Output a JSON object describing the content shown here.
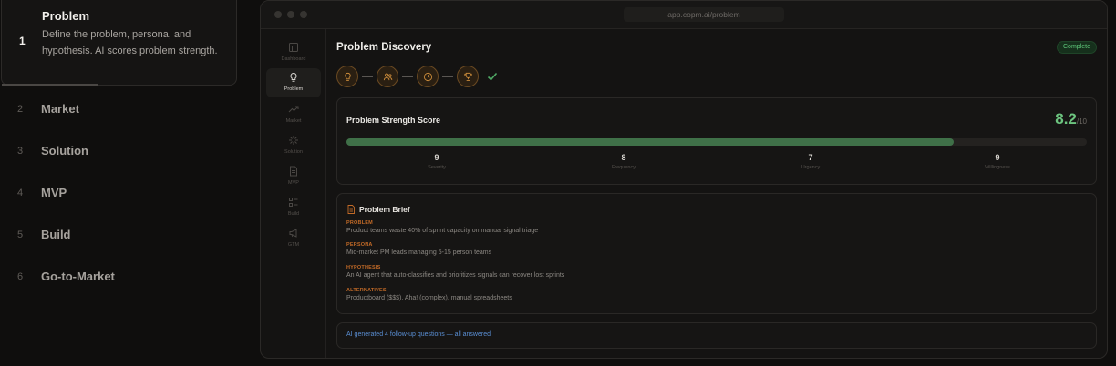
{
  "steps": {
    "active": {
      "number": "1",
      "title": "Problem",
      "description": "Define the problem, persona, and hypothesis. AI scores problem strength."
    },
    "items": [
      {
        "number": "2",
        "label": "Market"
      },
      {
        "number": "3",
        "label": "Solution"
      },
      {
        "number": "4",
        "label": "MVP"
      },
      {
        "number": "5",
        "label": "Build"
      },
      {
        "number": "6",
        "label": "Go-to-Market"
      }
    ]
  },
  "browser": {
    "url": "app.copm.ai/problem"
  },
  "sidenav": {
    "items": [
      {
        "label": "Dashboard",
        "icon": "dashboard-icon"
      },
      {
        "label": "Problem",
        "icon": "lightbulb-icon"
      },
      {
        "label": "Market",
        "icon": "trend-icon"
      },
      {
        "label": "Solution",
        "icon": "sparkle-icon"
      },
      {
        "label": "MVP",
        "icon": "document-icon"
      },
      {
        "label": "Build",
        "icon": "list-icon"
      },
      {
        "label": "GTM",
        "icon": "megaphone-icon"
      }
    ]
  },
  "main": {
    "title": "Problem Discovery",
    "status": "Complete"
  },
  "stages": [
    "lightbulb-icon",
    "users-icon",
    "clock-icon",
    "trophy-icon",
    "check-icon"
  ],
  "score": {
    "title": "Problem Strength Score",
    "value": "8.2",
    "max": "/10",
    "fill_fraction": 0.82,
    "metrics": [
      {
        "value": "9",
        "label": "Severity"
      },
      {
        "value": "8",
        "label": "Frequency"
      },
      {
        "value": "7",
        "label": "Urgency"
      },
      {
        "value": "9",
        "label": "Willingness"
      }
    ]
  },
  "brief": {
    "title": "Problem Brief",
    "sections": [
      {
        "key": "PROBLEM",
        "value": "Product teams waste 40% of sprint capacity on manual signal triage"
      },
      {
        "key": "PERSONA",
        "value": "Mid-market PM leads managing 5-15 person teams"
      },
      {
        "key": "HYPOTHESIS",
        "value": "An AI agent that auto-classifies and prioritizes signals can recover lost sprints"
      },
      {
        "key": "ALTERNATIVES",
        "value": "Productboard ($$$), Aha! (complex), manual spreadsheets"
      }
    ]
  },
  "ai_note": "AI generated 4 follow-up questions — all answered",
  "colors": {
    "accent_green": "#6cc47f",
    "accent_orange": "#c26a27",
    "accent_blue": "#5a8fd4"
  }
}
